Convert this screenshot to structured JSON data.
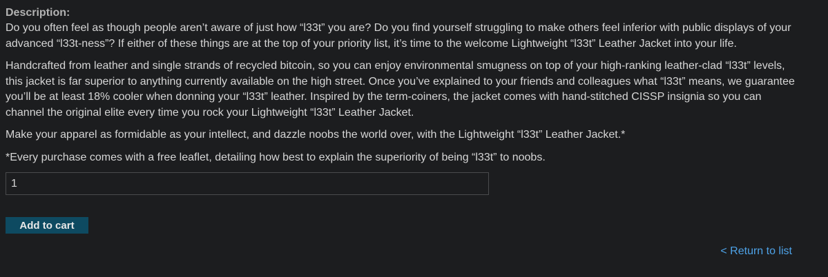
{
  "description": {
    "heading": "Description:",
    "paragraphs": [
      "Do you often feel as though people aren’t aware of just how “l33t” you are? Do you find yourself struggling to make others feel inferior with public displays of your advanced “l33t-ness”? If either of these things are at the top of your priority list, it’s time to the welcome Lightweight “l33t” Leather Jacket into your life.",
      "Handcrafted from leather and single strands of recycled bitcoin, so you can enjoy environmental smugness on top of your high-ranking leather-clad “l33t” levels, this jacket is far superior to anything currently available on the high street. Once you’ve explained to your friends and colleagues what “l33t” means, we guarantee you’ll be at least 18% cooler when donning your “l33t” leather. Inspired by the term-coiners, the jacket comes with hand-stitched CISSP insignia so you can channel the original elite every time you rock your Lightweight “l33t” Leather Jacket.",
      "Make your apparel as formidable as your intellect, and dazzle noobs the world over, with the Lightweight “l33t” Leather Jacket.*",
      "*Every purchase comes with a free leaflet, detailing how best to explain the superiority of being “l33t” to noobs."
    ]
  },
  "cart": {
    "quantity_value": "1",
    "add_button_label": "Add to cart"
  },
  "nav": {
    "return_link_label": "< Return to list"
  },
  "colors": {
    "background": "#1c1d1f",
    "text": "#d6d6d6",
    "button": "#0e4a61",
    "link": "#4ea3e8"
  }
}
